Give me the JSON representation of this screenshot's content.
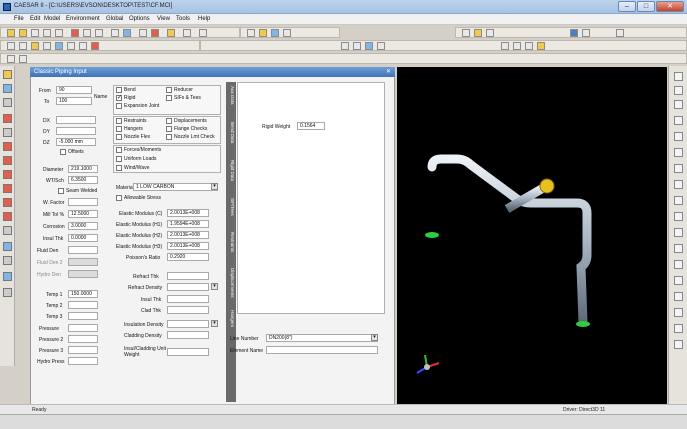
{
  "window": {
    "title": "CAESAR II - [C:\\USERS\\EVSON\\DESKTOP\\TEST\\CF.MCI]"
  },
  "menu": [
    "File",
    "Edit",
    "Model",
    "Environment",
    "Global",
    "Options",
    "View",
    "Tools",
    "Help"
  ],
  "panel": {
    "title": "Classic Piping Input"
  },
  "left": {
    "from_label": "From",
    "from_value": "90",
    "to_label": "To",
    "to_value": "100",
    "name_label": "Name",
    "dx_label": "DX",
    "dy_label": "DY",
    "dz_label": "DZ",
    "dz_value": "-5.000 mm",
    "offsets_label": "Offsets",
    "diameter_label": "Diameter",
    "diameter_value": "219.1000",
    "wt_label": "WT/Sch",
    "wt_value": "6.3500",
    "seam_label": "Seam Welded",
    "wfactor_label": "W. Factor",
    "milltol_label": "Mill Tol %",
    "milltol_value": "12.5000",
    "corrosion_label": "Corrosion",
    "corrosion_value": "3.0000",
    "insul_label": "Insul Thk",
    "insul_value": "0.0000",
    "fluid_label": "Fluid Den",
    "fluid_den1_label": "Fluid Den 2",
    "fluid_den2_label": "Hydro Den",
    "temp1_label": "Temp 1",
    "temp1_value": "150.0000",
    "temp2_label": "Temp 2",
    "temp3_label": "Temp 3",
    "pressure_label": "Pressure",
    "pressure2_label": "Pressure 2",
    "pressure3_label": "Pressure 3",
    "hydro_label": "Hydro Press"
  },
  "mid": {
    "bend": "Bend",
    "rigid": "Rigid",
    "expansion": "Expansion Joint",
    "reducer": "Reducer",
    "sif": "SIFs & Tees",
    "restraints": "Restraints",
    "hangers": "Hangers",
    "nozzle": "Nozzle Flex",
    "displacements": "Displacements",
    "flange": "Flange Checks",
    "nozzle_limit": "Nozzle Lmt Check",
    "forces": "Forces/Moments",
    "uniform": "Uniform Loads",
    "wind": "Wind/Wave",
    "material_label": "Material",
    "material_value": "1 LOW CARBON",
    "allowable": "Allowable Stress",
    "elastic1": "Elastic Modulus (C)",
    "elastic1_val": "2.0013E+008",
    "elastic2": "Elastic Modulus (H1)",
    "elastic2_val": "1.9594E+008",
    "elastic3": "Elastic Modulus (H2)",
    "elastic3_val": "2.0013E+008",
    "elastic4": "Elastic Modulus (H3)",
    "elastic4_val": "2.0013E+008",
    "poisson": "Poisson's Ratio",
    "poisson_val": "0.2920",
    "refract": "Refract Thk",
    "refract_den": "Refract Density",
    "insul_thk": "Insul Thk",
    "clad_thk": "Clad Thk",
    "insul_den": "Insulation Density",
    "clad_den": "Cladding Density",
    "insul_clad": "Insul/Cladding Unit Weight"
  },
  "right": {
    "rigid_weight_label": "Rigid Weight",
    "rigid_weight_value": "0.1564",
    "line_number_label": "Line Number",
    "line_number_value": "DN200(8\")",
    "element_name_label": "Element Name"
  },
  "vtabs": [
    "Aux Data",
    "Bend Data",
    "Rigid Data",
    "SIF/Tees",
    "Restraints",
    "Displacements",
    "Hangers"
  ],
  "status": {
    "ready": "Ready",
    "driver": "Driver: Direct3D 11"
  }
}
